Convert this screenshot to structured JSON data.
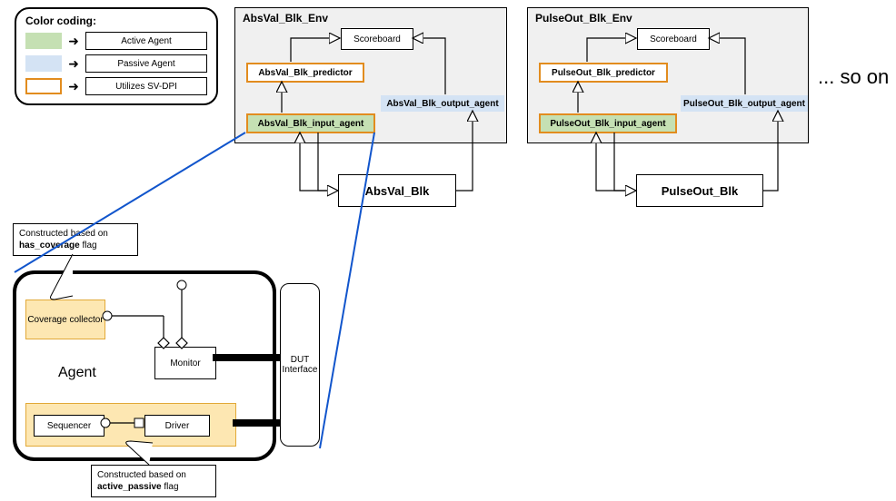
{
  "legend": {
    "title": "Color coding:",
    "rows": [
      {
        "label": "Active Agent"
      },
      {
        "label": "Passive Agent"
      },
      {
        "label": "Utilizes SV-DPI"
      }
    ]
  },
  "envs": [
    {
      "title": "AbsVal_Blk_Env",
      "scoreboard": "Scoreboard",
      "predictor": "AbsVal_Blk_predictor",
      "input_agent": "AbsVal_Blk_input_agent",
      "output_agent": "AbsVal_Blk_output_agent",
      "dut": "AbsVal_Blk"
    },
    {
      "title": "PulseOut_Blk_Env",
      "scoreboard": "Scoreboard",
      "predictor": "PulseOut_Blk_predictor",
      "input_agent": "PulseOut_Blk_input_agent",
      "output_agent": "PulseOut_Blk_output_agent",
      "dut": "PulseOut_Blk"
    }
  ],
  "so_on": "... so on",
  "agent": {
    "title": "Agent",
    "coverage": "Coverage collector",
    "monitor": "Monitor",
    "sequencer": "Sequencer",
    "driver": "Driver",
    "dut_if": "DUT Interface"
  },
  "callouts": {
    "has_coverage_pre": "Constructed based on ",
    "has_coverage_flag": "has_coverage",
    "has_coverage_post": " flag",
    "active_passive_pre": "Constructed based on ",
    "active_passive_flag": "active_passive",
    "active_passive_post": " flag"
  }
}
